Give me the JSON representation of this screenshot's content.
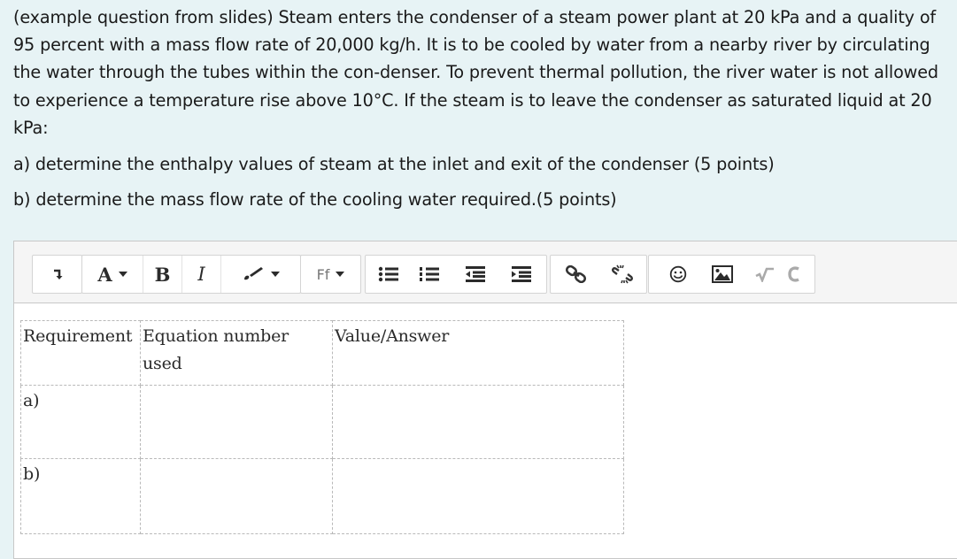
{
  "question": {
    "intro": "(example question from slides) Steam enters the condenser of a steam power plant at 20 kPa and a quality of 95 percent with a mass flow rate of 20,000 kg/h. It is to be cooled by water from a nearby river by circulating the water through the tubes within the con-denser. To prevent thermal pollution, the river water is not allowed to experience a temperature rise above 10°C. If the steam is to leave the condenser as saturated liquid at 20 kPa:",
    "part_a": "a) determine the enthalpy values of steam at the inlet and exit of the condenser (5 points)",
    "part_b": "b) determine the mass flow rate of the cooling water required.(5 points)"
  },
  "toolbar": {
    "font_label": "A",
    "bold_label": "B",
    "italic_label": "I",
    "font_family_label": "Ff",
    "icons": [
      "collapse-icon",
      "font-color-icon",
      "bold-icon",
      "italic-icon",
      "paint-brush-icon",
      "font-family-icon",
      "bullet-list-icon",
      "numbered-list-icon",
      "outdent-icon",
      "indent-icon",
      "link-icon",
      "unlink-icon",
      "emoji-icon",
      "image-icon",
      "equation-icon",
      "undo-icon"
    ]
  },
  "table": {
    "headers": [
      "Requirement",
      "Equation number used",
      "Value/Answer"
    ],
    "rows": [
      [
        "a)",
        "",
        ""
      ],
      [
        "b)",
        "",
        ""
      ]
    ]
  },
  "colors": {
    "page_background": "#e7f3f5",
    "toolbar_background": "#f5f5f5",
    "link_icon": "#333333"
  }
}
